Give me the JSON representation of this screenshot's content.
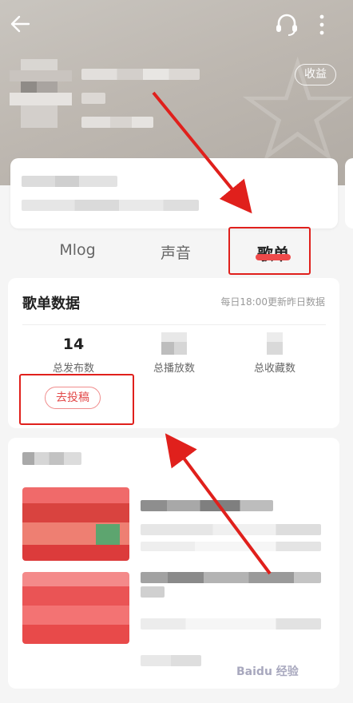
{
  "header": {
    "income_label": "收益"
  },
  "tabs": [
    {
      "label": "Mlog",
      "active": false
    },
    {
      "label": "声音",
      "active": false
    },
    {
      "label": "歌单",
      "active": true
    }
  ],
  "playlist_data": {
    "title": "歌单数据",
    "update_note": "每日18:00更新昨日数据",
    "stats": [
      {
        "value": "14",
        "label": "总发布数"
      },
      {
        "value": "",
        "label": "总播放数"
      },
      {
        "value": "",
        "label": "总收藏数"
      }
    ],
    "submit_label": "去投稿"
  },
  "watermark": "Baidu 经验",
  "colors": {
    "accent": "#ef4a4a",
    "annotation": "#e0201c"
  },
  "icons": [
    "back-arrow-icon",
    "headset-icon",
    "more-vertical-icon",
    "star-decoration-icon"
  ]
}
